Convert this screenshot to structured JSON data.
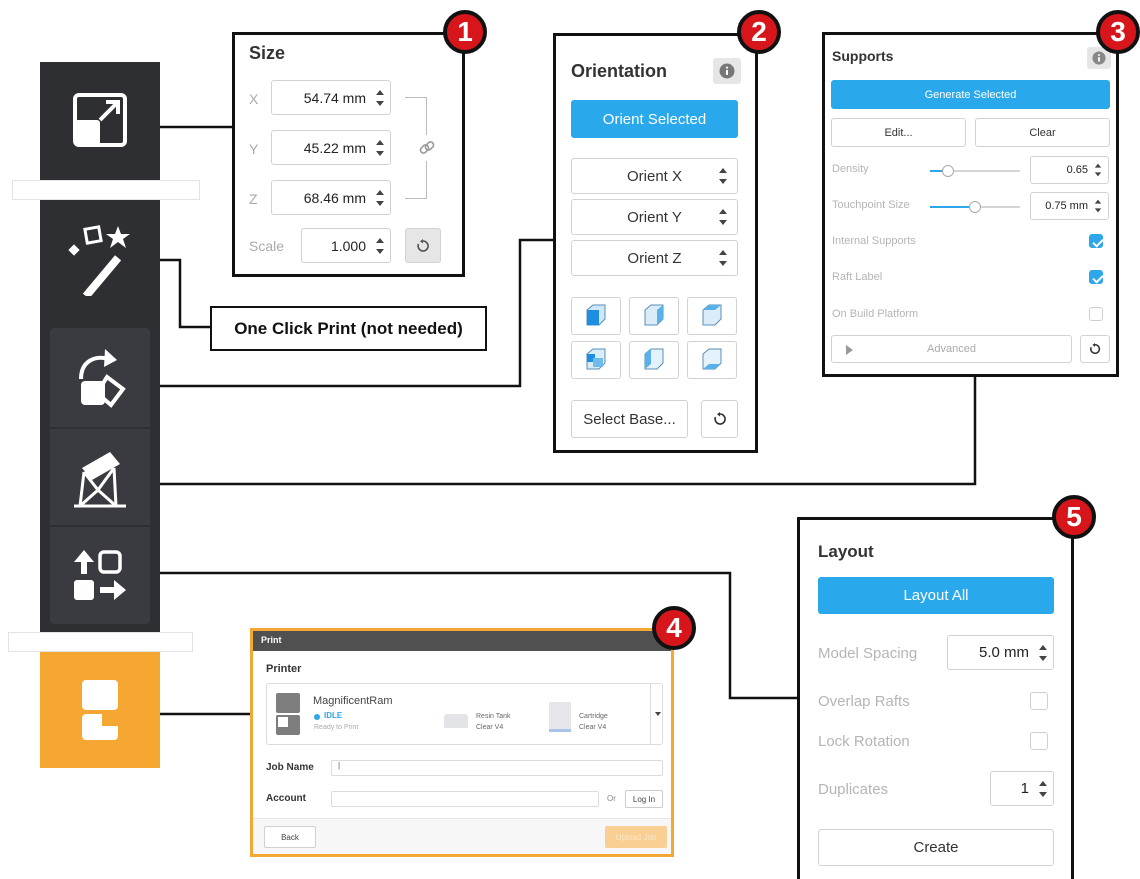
{
  "callouts": {
    "one_click_print": "One Click Print (not needed)"
  },
  "badges": [
    "1",
    "2",
    "3",
    "4",
    "5"
  ],
  "toolbar": {
    "icons": [
      "scale-icon",
      "magic-wand-icon",
      "orientation-icon",
      "supports-icon",
      "layout-icon",
      "print-icon"
    ],
    "accent_color": "#f5a731",
    "background_color": "#2e2f33"
  },
  "size_panel": {
    "title": "Size",
    "rows": [
      {
        "axis": "X",
        "value": "54.74 mm"
      },
      {
        "axis": "Y",
        "value": "45.22 mm"
      },
      {
        "axis": "Z",
        "value": "68.46 mm"
      }
    ],
    "scale_label": "Scale",
    "scale_value": "1.000"
  },
  "orientation_panel": {
    "title": "Orientation",
    "orient_selected": "Orient Selected",
    "orient_x": "Orient X",
    "orient_y": "Orient Y",
    "orient_z": "Orient Z",
    "select_base": "Select Base..."
  },
  "supports_panel": {
    "title": "Supports",
    "generate_selected": "Generate Selected",
    "edit": "Edit...",
    "clear": "Clear",
    "density_label": "Density",
    "density_value": "0.65",
    "density_level": 0.2,
    "touchpoint_label": "Touchpoint Size",
    "touchpoint_value": "0.75 mm",
    "touchpoint_level": 0.5,
    "internal_supports": "Internal Supports",
    "raft_label": "Raft Label",
    "on_build_platform": "On Build Platform",
    "advanced": "Advanced"
  },
  "print_dialog": {
    "title": "Print",
    "printer_heading": "Printer",
    "printer_name": "MagnificentRam",
    "status": "IDLE",
    "status_detail": "Ready to Print",
    "resin_tank_label": "Resin Tank",
    "resin_tank_value": "Clear V4",
    "cartridge_label": "Cartridge",
    "cartridge_value": "Clear V4",
    "job_name_label": "Job Name",
    "job_name_value": "|",
    "account_label": "Account",
    "or_text": "Or",
    "log_in": "Log In",
    "back": "Back",
    "upload_job": "Upload Job"
  },
  "layout_panel": {
    "title": "Layout",
    "layout_all": "Layout All",
    "model_spacing_label": "Model Spacing",
    "model_spacing_value": "5.0 mm",
    "overlap_rafts": "Overlap Rafts",
    "lock_rotation": "Lock Rotation",
    "duplicates_label": "Duplicates",
    "duplicates_value": "1",
    "create": "Create"
  }
}
